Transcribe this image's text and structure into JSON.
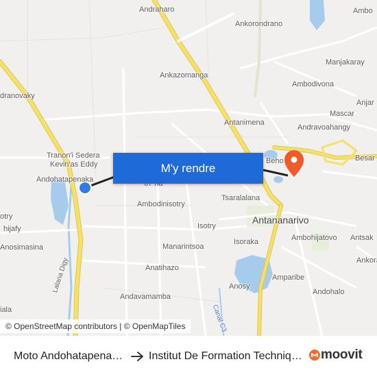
{
  "map": {
    "route_button": "M'y rendre",
    "attribution": "© OpenStreetMap contributors | © OpenMapTiles",
    "labels": {
      "andraharo": "Andraharo",
      "ankorondrano": "Ankorondrano",
      "ambo": "Ambo",
      "manjakaray": "Manjakaray",
      "dranovaky": "dranovaky",
      "ankazomanga": "Ankazomanga",
      "ambodivona": "Ambodivona",
      "anjar": "Anjar",
      "mascar": "Mascar",
      "antanimena": "Antanimena",
      "andravoahangy": "Andravoahangy",
      "tranon_i_sedera": "Tranon'i Sedera",
      "kevin_as_eddy": "Kevin'as Eddy",
      "besar": "Besar",
      "beho": "Beho",
      "andohatapenaka": "Andohatapenaka",
      "ha_67": "67 ha",
      "tsaralalana": "Tsaralalana",
      "ambodinisotry": "Ambodinisotry",
      "antananarivo": "Antananarivo",
      "isotry": "Isotry",
      "otry": "otry",
      "hijafy": "hijafy",
      "anosimasina": "Anosimasina",
      "ambohijatovo": "Ambohijatovo",
      "antsak": "Antsak",
      "manarintsoa": "Manarintsoa",
      "isoraka": "Isoraka",
      "ankora": "Ankora",
      "anatihazo": "Anatihazo",
      "amparibe": "Amparibe",
      "anosy": "Anosy",
      "andohalo": "Andohalo",
      "andavamamba": "Andavamamba",
      "lalana_digy": "Lalana Digy",
      "canal_c3": "Canal C3",
      "iala": "iala"
    }
  },
  "footer": {
    "origin": "Moto Andohatapenaka",
    "destination": "Institut De Formation Technique",
    "brand": "moovit"
  },
  "colors": {
    "button": "#1e6ad8",
    "origin_marker": "#2f7de1",
    "destination_marker": "#f05a28",
    "water": "#a7cbeb",
    "major_road": "#f3e16a",
    "brand_accent": "#f26a2e"
  },
  "icons": {
    "origin": "origin-dot-icon",
    "destination": "destination-pin-icon",
    "arrow": "arrow-right-icon",
    "brand": "moovit-logo-icon"
  }
}
